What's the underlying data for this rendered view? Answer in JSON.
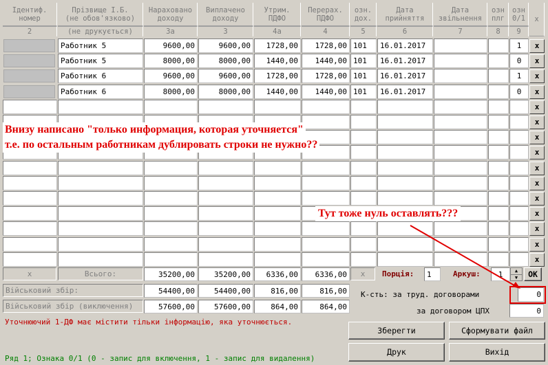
{
  "header": {
    "cols": [
      {
        "l1": "Ідентиф.",
        "l2": "номер",
        "sub": "2"
      },
      {
        "l1": "Прізвище І.Б.",
        "l2": "(не обов'язково)",
        "sub": "(не друкується)"
      },
      {
        "l1": "Нараховано",
        "l2": "доходу",
        "sub": "3а"
      },
      {
        "l1": "Виплачено",
        "l2": "доходу",
        "sub": "3"
      },
      {
        "l1": "Утрим.",
        "l2": "ПДФО",
        "sub": "4а"
      },
      {
        "l1": "Перерах.",
        "l2": "ПДФО",
        "sub": "4"
      },
      {
        "l1": "озн.",
        "l2": "дох.",
        "sub": "5"
      },
      {
        "l1": "Дата",
        "l2": "прийняття",
        "sub": "6"
      },
      {
        "l1": "Дата",
        "l2": "звільнення",
        "sub": "7"
      },
      {
        "l1": "озн",
        "l2": "плг",
        "sub": "8"
      },
      {
        "l1": "озн",
        "l2": "0/1",
        "sub": "9"
      }
    ],
    "x_label": "x"
  },
  "rows": [
    {
      "id": "",
      "name": "Работник 5",
      "accrued": "9600,00",
      "paid": "9600,00",
      "withheld": "1728,00",
      "transferred": "1728,00",
      "income_code": "101",
      "hire_date": "16.01.2017",
      "dismiss_date": "",
      "priv": "",
      "flag": "1"
    },
    {
      "id": "",
      "name": "Работник 5",
      "accrued": "8000,00",
      "paid": "8000,00",
      "withheld": "1440,00",
      "transferred": "1440,00",
      "income_code": "101",
      "hire_date": "16.01.2017",
      "dismiss_date": "",
      "priv": "",
      "flag": "0"
    },
    {
      "id": "",
      "name": "Работник 6",
      "accrued": "9600,00",
      "paid": "9600,00",
      "withheld": "1728,00",
      "transferred": "1728,00",
      "income_code": "101",
      "hire_date": "16.01.2017",
      "dismiss_date": "",
      "priv": "",
      "flag": "1"
    },
    {
      "id": "",
      "name": "Работник 6",
      "accrued": "8000,00",
      "paid": "8000,00",
      "withheld": "1440,00",
      "transferred": "1440,00",
      "income_code": "101",
      "hire_date": "16.01.2017",
      "dismiss_date": "",
      "priv": "",
      "flag": "0"
    }
  ],
  "delete_label": "x",
  "totals": {
    "x1": "x",
    "label": "Всього:",
    "accrued": "35200,00",
    "paid": "35200,00",
    "withheld": "6336,00",
    "transferred": "6336,00",
    "x2": "x"
  },
  "military": {
    "label": "Військовий збір:",
    "accrued": "54400,00",
    "paid": "54400,00",
    "withheld": "816,00",
    "transferred": "816,00"
  },
  "military_excl": {
    "label": "Військовий збір (виключення)",
    "accrued": "57600,00",
    "paid": "57600,00",
    "withheld": "864,00",
    "transferred": "864,00"
  },
  "portion": {
    "label": "Порція:",
    "value": "1"
  },
  "sheet": {
    "label": "Аркуш:",
    "value": "1",
    "ok": "OK"
  },
  "counts": {
    "labor_label": "К-сть: за труд. договорами",
    "labor_value": "0",
    "gph_label": "за договором ЦПХ",
    "gph_value": "0"
  },
  "buttons": {
    "save": "Зберегти",
    "form_file": "Сформувати файл",
    "print": "Друк",
    "exit": "Вихід"
  },
  "warning": "Уточнюючий 1-ДФ має містити тільки інформацію, яка уточнюється.",
  "status": "Ряд 1; Ознака 0/1 (0 - запис для включення, 1 - запис для видалення)",
  "annotations": {
    "main_line1": "Внизу написано \"только информация, которая уточняется\"",
    "main_line2": "т.е. по остальным работникам дублировать строки не нужно??",
    "zero_question": "Тут тоже нуль оставлять???"
  },
  "colors": {
    "window_bg": "#d4d0c8",
    "annotation_red": "#e00000",
    "warning_red": "#c00000",
    "status_green": "#008000"
  }
}
